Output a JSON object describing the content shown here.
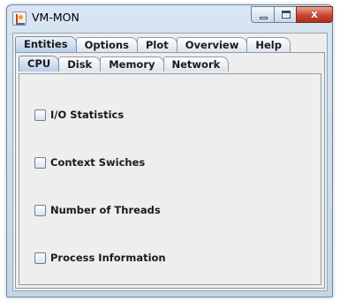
{
  "window": {
    "title": "VM-MON",
    "close_glyph": "x"
  },
  "main_tabs": [
    {
      "label": "Entities",
      "selected": true
    },
    {
      "label": "Options",
      "selected": false
    },
    {
      "label": "Plot",
      "selected": false
    },
    {
      "label": "Overview",
      "selected": false
    },
    {
      "label": "Help",
      "selected": false
    }
  ],
  "sub_tabs": [
    {
      "label": "CPU",
      "selected": true
    },
    {
      "label": "Disk",
      "selected": false
    },
    {
      "label": "Memory",
      "selected": false
    },
    {
      "label": "Network",
      "selected": false
    }
  ],
  "checkboxes": [
    {
      "label": "I/O Statistics",
      "checked": false
    },
    {
      "label": "Context Swiches",
      "checked": false
    },
    {
      "label": "Number of Threads",
      "checked": false
    },
    {
      "label": "Process Information",
      "checked": false
    }
  ]
}
